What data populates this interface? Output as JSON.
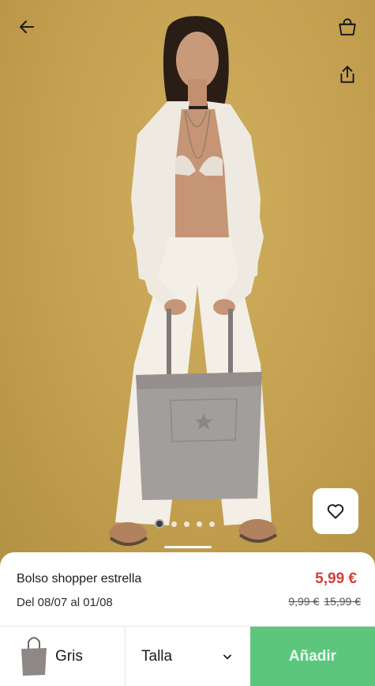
{
  "header": {
    "back_icon": "arrow-left-icon",
    "cart_icon": "shopping-bag-icon",
    "share_icon": "share-icon"
  },
  "gallery": {
    "image_count": 5,
    "active_index": 0,
    "favorite_icon": "heart-icon"
  },
  "product": {
    "name": "Bolso shopper estrella",
    "dates": "Del 08/07 al 01/08",
    "price": "5,99 €",
    "old_prices": [
      "9,99 €",
      "15,99 €"
    ],
    "price_color": "#d0413b"
  },
  "actions": {
    "color_label": "Gris",
    "size_label": "Talla",
    "add_label": "Añadir",
    "add_color": "#5cc77c"
  }
}
